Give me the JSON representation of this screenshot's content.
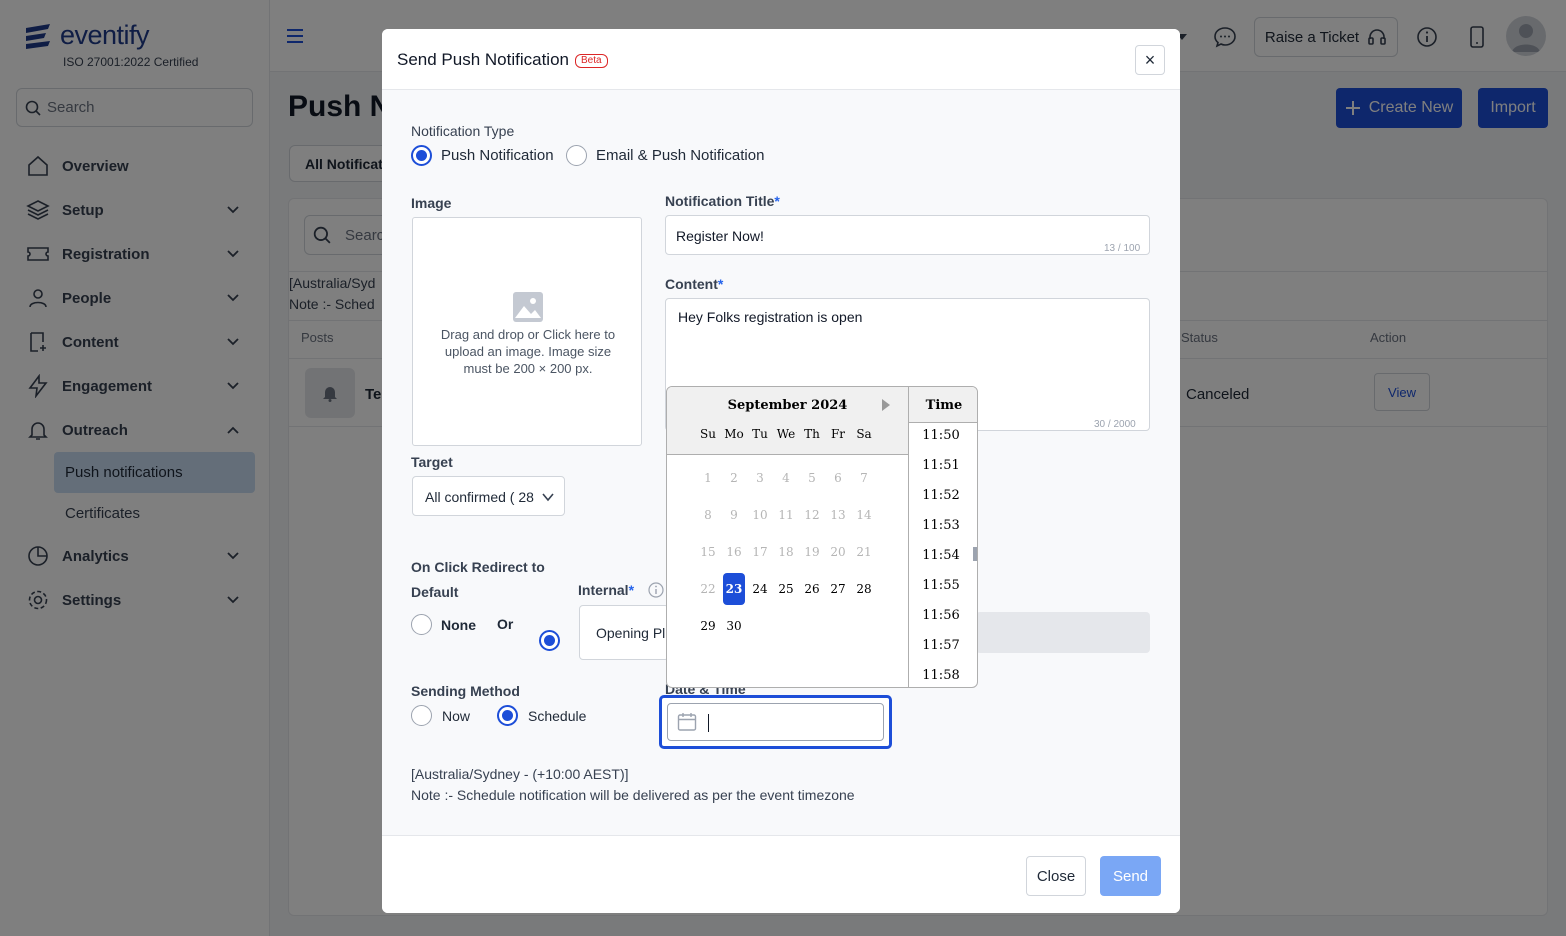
{
  "brand": {
    "name": "eventify",
    "certification": "ISO 27001:2022 Certified"
  },
  "sidebar": {
    "search_placeholder": "Search",
    "items": [
      {
        "label": "Overview"
      },
      {
        "label": "Setup"
      },
      {
        "label": "Registration"
      },
      {
        "label": "People"
      },
      {
        "label": "Content"
      },
      {
        "label": "Engagement"
      },
      {
        "label": "Outreach"
      }
    ],
    "outreach_sub": [
      {
        "label": "Push notifications"
      },
      {
        "label": "Certificates"
      }
    ],
    "items_after": [
      {
        "label": "Analytics"
      },
      {
        "label": "Settings"
      }
    ]
  },
  "topbar": {
    "raise_ticket": "Raise a Ticket"
  },
  "page": {
    "title": "Push N",
    "create_new": "Create New",
    "import": "Import",
    "filter_tab": "All Notificat",
    "search_placeholder": "Searc",
    "tz_line": "[Australia/Syd",
    "note_line": "Note :- Sched",
    "table": {
      "col_posts": "Posts",
      "col_status": "Status",
      "col_action": "Action",
      "row_title": "Te",
      "row_status": "Canceled",
      "row_action": "View"
    }
  },
  "modal": {
    "title": "Send Push Notification",
    "beta": "Beta",
    "notification_type": {
      "label": "Notification Type",
      "options": [
        "Push Notification",
        "Email & Push Notification"
      ],
      "selected": "Push Notification"
    },
    "image": {
      "label": "Image",
      "hint": "Drag and drop or Click here to upload an image. Image size must be 200 × 200 px."
    },
    "notif_title": {
      "label": "Notification Title",
      "value": "Register Now!",
      "counter": "13 / 100"
    },
    "content": {
      "label": "Content",
      "value": "Hey Folks registration is open",
      "counter": "30 / 2000"
    },
    "target": {
      "label": "Target",
      "value": "All confirmed ( 28"
    },
    "redirect": {
      "label": "On Click Redirect to",
      "default_label": "Default",
      "none": "None",
      "or": "Or",
      "internal_label": "Internal",
      "internal_value": "Opening Pl"
    },
    "sending": {
      "label": "Sending Method",
      "options": [
        "Now",
        "Schedule"
      ],
      "selected": "Schedule"
    },
    "datetime_label": "Date & Time",
    "timezone": "[Australia/Sydney - (+10:00 AEST)]",
    "note": "Note :- Schedule notification will be delivered as per the event timezone",
    "footer": {
      "close": "Close",
      "send": "Send"
    }
  },
  "datepicker": {
    "month": "September 2024",
    "day_names": [
      "Su",
      "Mo",
      "Tu",
      "We",
      "Th",
      "Fr",
      "Sa"
    ],
    "weeks": [
      [
        "1",
        "2",
        "3",
        "4",
        "5",
        "6",
        "7"
      ],
      [
        "8",
        "9",
        "10",
        "11",
        "12",
        "13",
        "14"
      ],
      [
        "15",
        "16",
        "17",
        "18",
        "19",
        "20",
        "21"
      ],
      [
        "22",
        "23",
        "24",
        "25",
        "26",
        "27",
        "28"
      ],
      [
        "29",
        "30"
      ]
    ],
    "selected_day": "23",
    "time_header": "Time",
    "times": [
      "11:50",
      "11:51",
      "11:52",
      "11:53",
      "11:54",
      "11:55",
      "11:56",
      "11:57",
      "11:58"
    ]
  }
}
